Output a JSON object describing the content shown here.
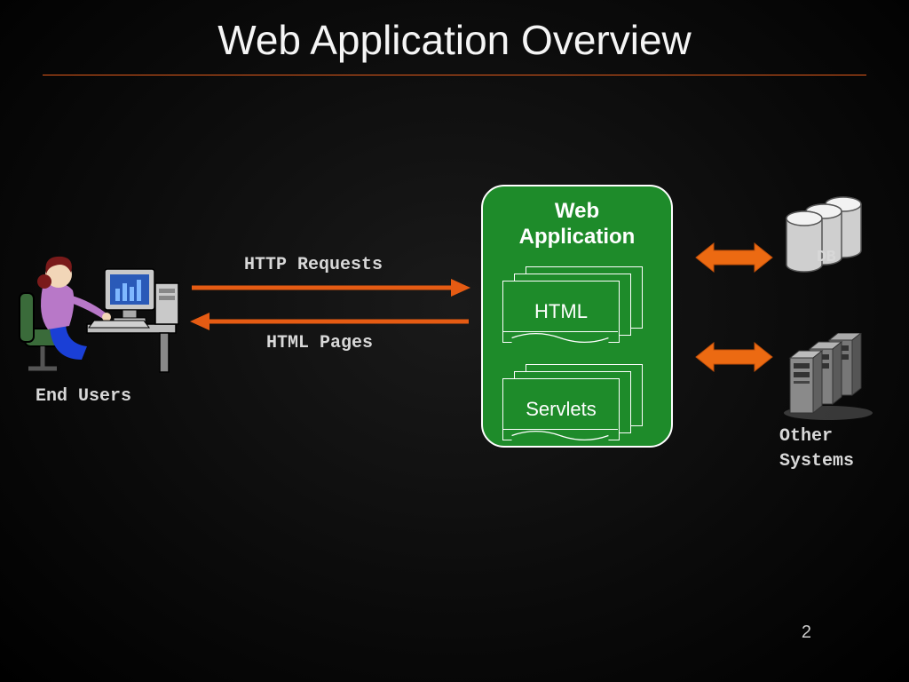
{
  "slide": {
    "title": "Web Application Overview",
    "page_number": "2"
  },
  "labels": {
    "end_users": "End Users",
    "http_requests": "HTTP Requests",
    "html_pages": "HTML Pages",
    "web_application": "Web\nApplication",
    "html_block": "HTML",
    "servlets_block": "Servlets",
    "db": "DB",
    "other_systems": "Other\nSystems"
  },
  "colors": {
    "accent": "#e55b13",
    "webapp_green": "#1e8b2a"
  }
}
